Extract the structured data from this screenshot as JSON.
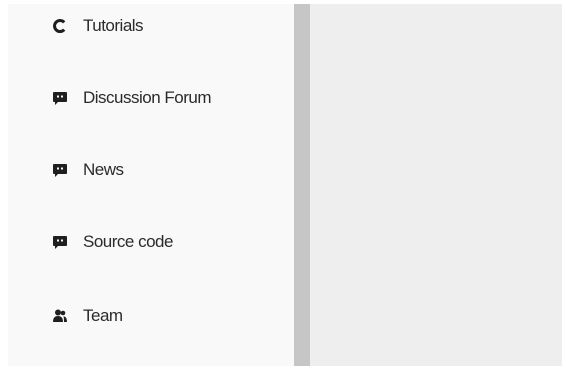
{
  "sidebar": {
    "items": [
      {
        "label": "Tutorials",
        "icon": "refresh-circle-icon"
      },
      {
        "label": "Discussion Forum",
        "icon": "chat-bubble-icon"
      },
      {
        "label": "News",
        "icon": "chat-bubble-icon"
      },
      {
        "label": "Source code",
        "icon": "chat-bubble-icon"
      },
      {
        "label": "Team",
        "icon": "users-icon"
      }
    ]
  },
  "colors": {
    "sidebar_bg": "#f9f9f9",
    "divider": "#c6c6c6",
    "content_bg": "#eeeeee",
    "text": "#2b2b2b",
    "icon": "#1f1f1f"
  }
}
